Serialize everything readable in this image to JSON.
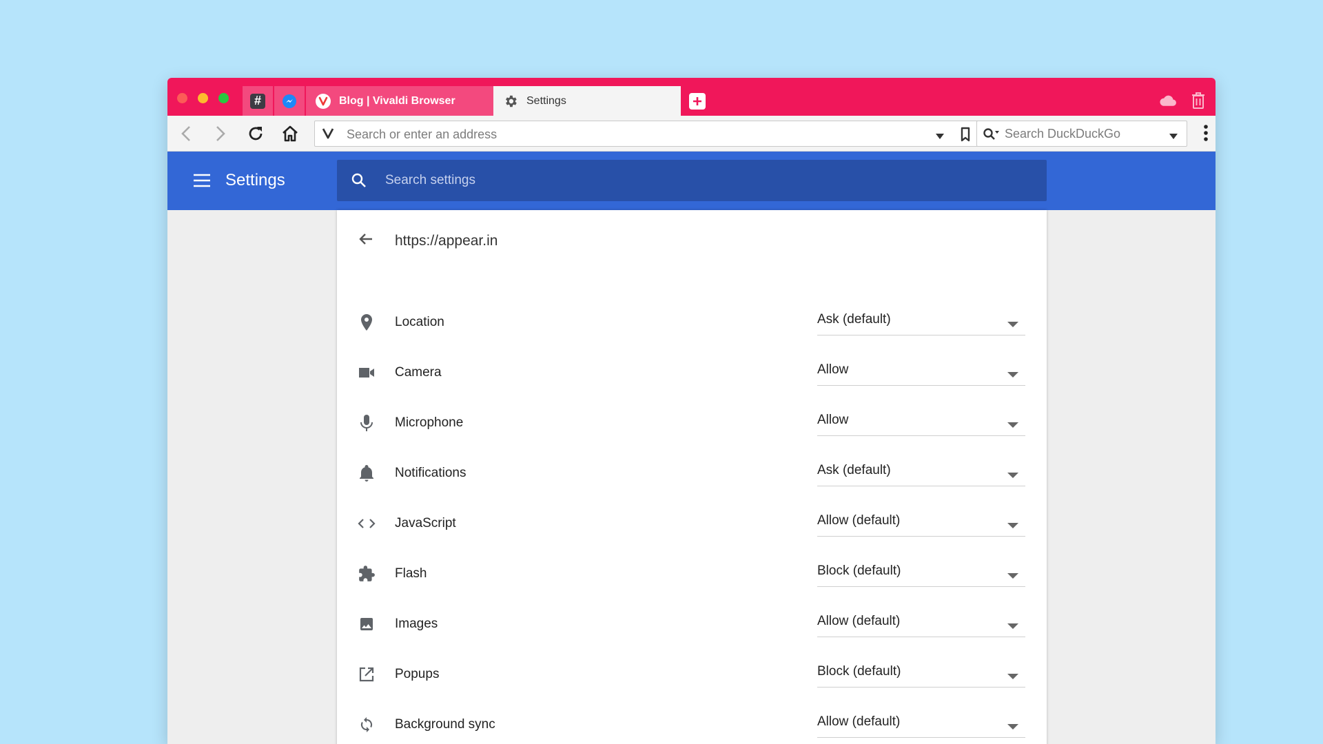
{
  "browser": {
    "pinned_tabs": [
      {
        "name": "slack",
        "glyph": "#"
      },
      {
        "name": "messenger"
      }
    ],
    "tabs": [
      {
        "label": "Blog | Vivaldi Browser",
        "icon": "vivaldi-icon",
        "active": false
      },
      {
        "label": "Settings",
        "icon": "gear-icon",
        "active": true
      }
    ],
    "address_bar": {
      "placeholder": "Search or enter an address"
    },
    "search_bar": {
      "placeholder": "Search DuckDuckGo"
    },
    "accent_color": "#f0175a"
  },
  "settings": {
    "title": "Settings",
    "search_placeholder": "Search settings",
    "header_color": "#3367d6"
  },
  "site": {
    "url": "https://appear.in",
    "permissions": [
      {
        "label": "Location",
        "value": "Ask (default)",
        "icon": "location-pin-icon"
      },
      {
        "label": "Camera",
        "value": "Allow",
        "icon": "camera-icon"
      },
      {
        "label": "Microphone",
        "value": "Allow",
        "icon": "microphone-icon"
      },
      {
        "label": "Notifications",
        "value": "Ask (default)",
        "icon": "bell-icon"
      },
      {
        "label": "JavaScript",
        "value": "Allow (default)",
        "icon": "code-icon"
      },
      {
        "label": "Flash",
        "value": "Block (default)",
        "icon": "puzzle-icon"
      },
      {
        "label": "Images",
        "value": "Allow (default)",
        "icon": "image-icon"
      },
      {
        "label": "Popups",
        "value": "Block (default)",
        "icon": "open-external-icon"
      },
      {
        "label": "Background sync",
        "value": "Allow (default)",
        "icon": "sync-icon"
      }
    ]
  }
}
